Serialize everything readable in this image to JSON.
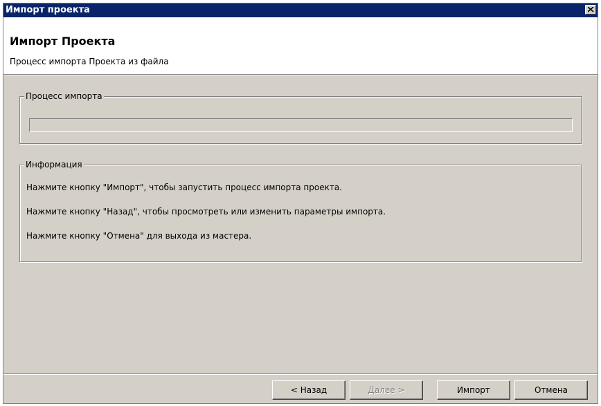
{
  "window": {
    "title": "Импорт проекта"
  },
  "header": {
    "title": "Импорт Проекта",
    "subtitle": "Процесс импорта Проекта из файла"
  },
  "progress_group": {
    "legend": "Процесс импорта",
    "progress_value": 0
  },
  "info_group": {
    "legend": "Информация",
    "lines": [
      "Нажмите кнопку \"Импорт\", чтобы запустить процесс импорта проекта.",
      "Нажмите кнопку \"Назад\", чтобы просмотреть или изменить параметры импорта.",
      "Нажмите кнопку \"Отмена\" для выхода из мастера."
    ]
  },
  "buttons": {
    "back": "< Назад",
    "next": "Далее >",
    "import": "Импорт",
    "cancel": "Отмена"
  },
  "colors": {
    "titlebar": "#0a246a",
    "face": "#d4d0c8"
  }
}
